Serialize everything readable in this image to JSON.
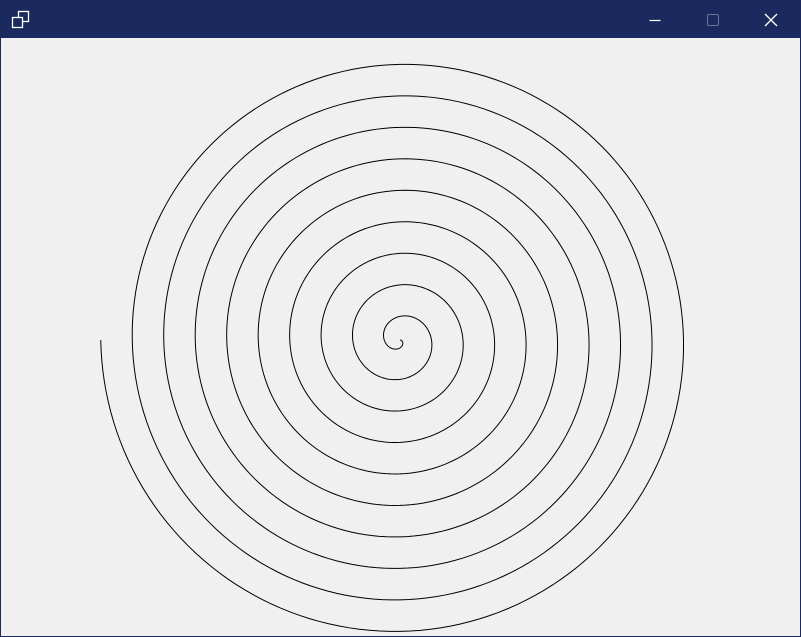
{
  "window": {
    "title": "",
    "colors": {
      "titlebar": "#1b2a5e",
      "client_background": "#f0f0f0",
      "caption_glyph": "#ffffff",
      "caption_glyph_disabled": "#6b7396",
      "spiral_stroke": "#000000"
    },
    "icons": {
      "app": "restore-windows-icon",
      "minimize": "minimize-icon",
      "maximize": "maximize-icon",
      "close": "close-icon"
    },
    "maximize_enabled": false
  },
  "drawing": {
    "shape": "archimedean-spiral",
    "turns": 9.5,
    "direction": "clockwise"
  }
}
